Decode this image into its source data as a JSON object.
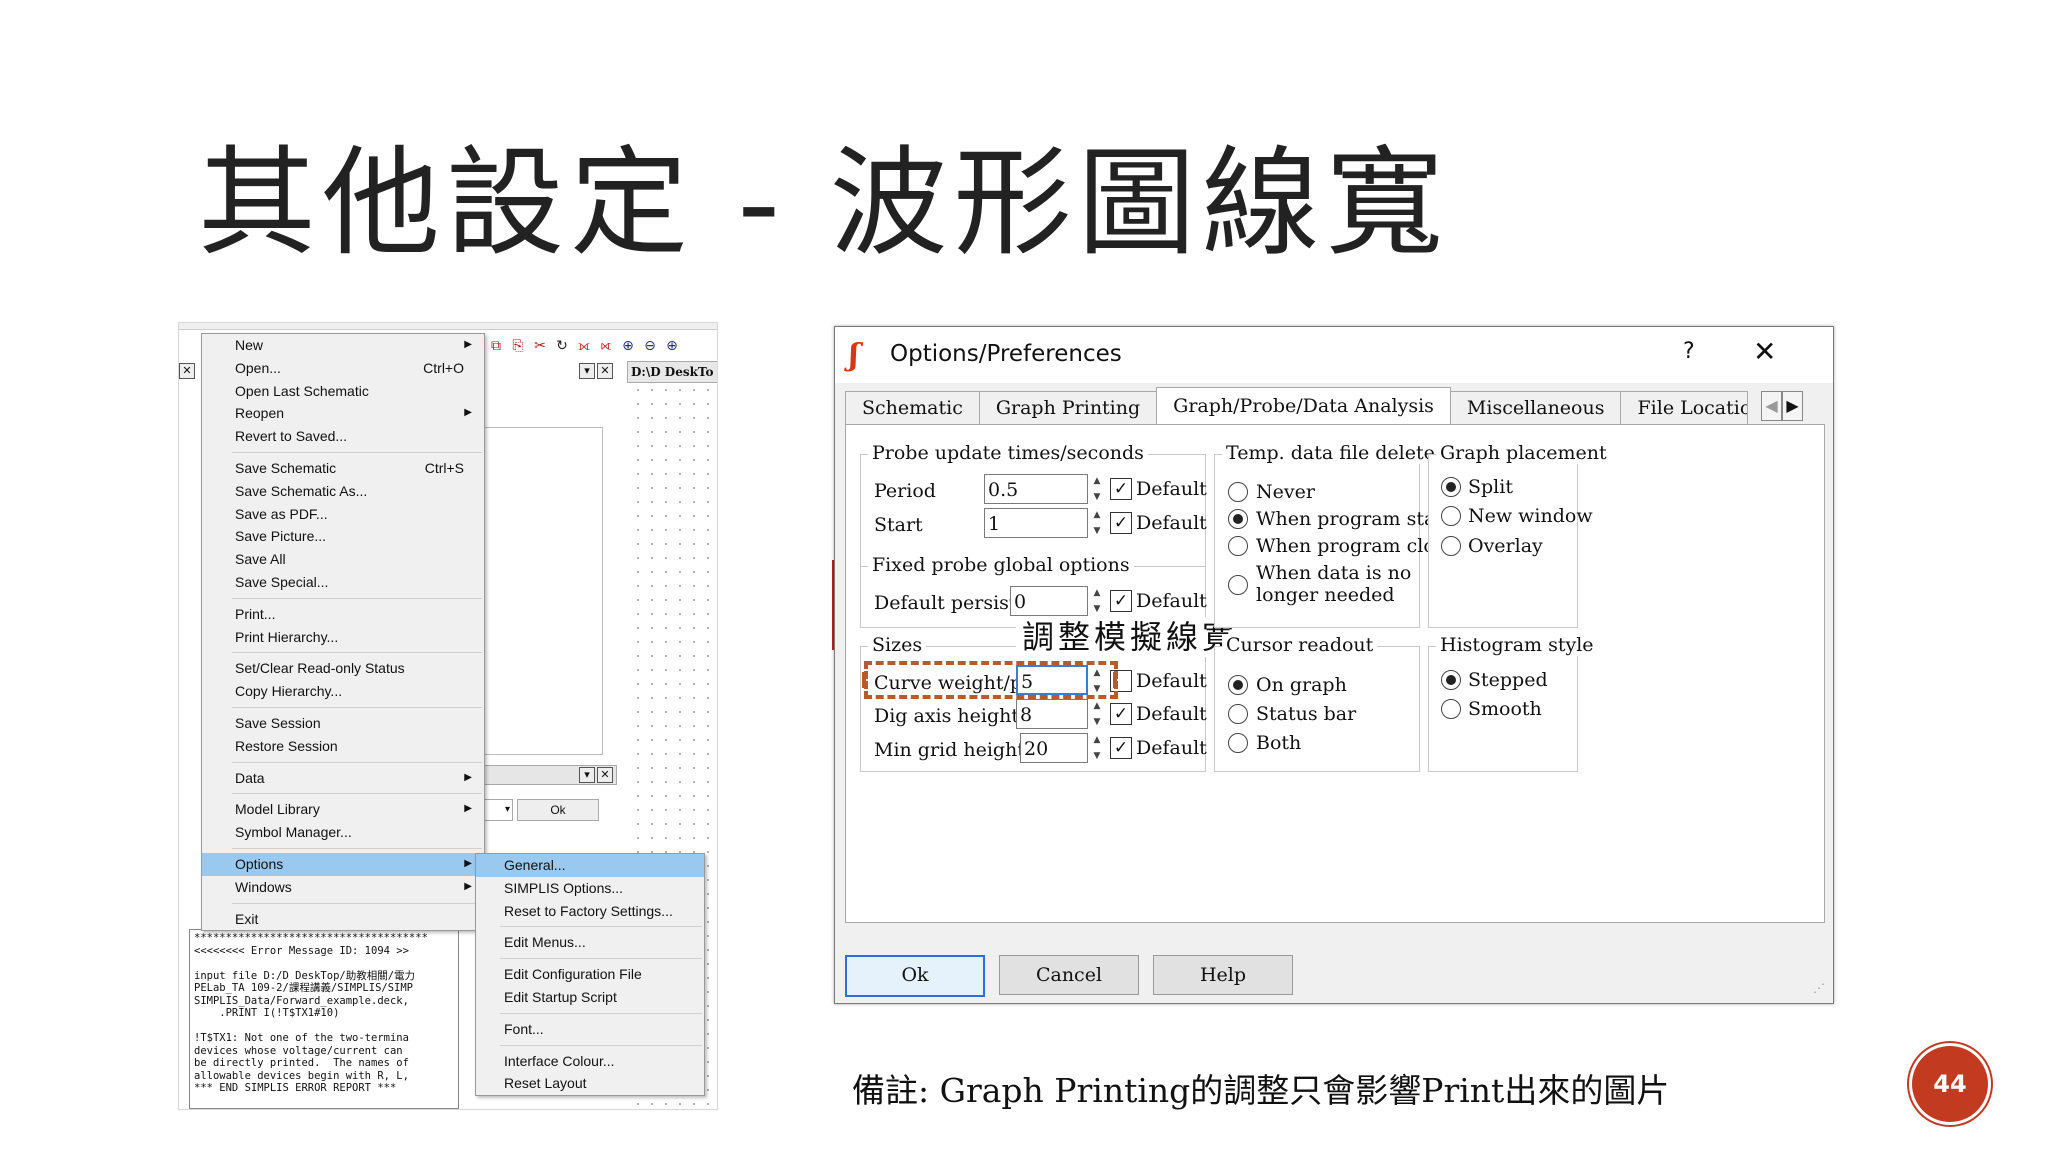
{
  "slide": {
    "title": "其他設定 - 波形圖線寬",
    "note": "備註: Graph Printing的調整只會影響Print出來的圖片",
    "page_number": "44",
    "accent_color": "#c23a1f"
  },
  "left_screenshot": {
    "file_menu": [
      {
        "label": "New",
        "shortcut": "",
        "submenu": true
      },
      {
        "label": "Open...",
        "shortcut": "Ctrl+O",
        "submenu": false
      },
      {
        "label": "Open Last Schematic",
        "shortcut": "",
        "submenu": false
      },
      {
        "label": "Reopen",
        "shortcut": "",
        "submenu": true
      },
      {
        "label": "Revert to Saved...",
        "shortcut": "",
        "submenu": false
      },
      {
        "label": "Save Schematic",
        "shortcut": "Ctrl+S",
        "submenu": false
      },
      {
        "label": "Save Schematic As...",
        "shortcut": "",
        "submenu": false
      },
      {
        "label": "Save as PDF...",
        "shortcut": "",
        "submenu": false
      },
      {
        "label": "Save Picture...",
        "shortcut": "",
        "submenu": false
      },
      {
        "label": "Save All",
        "shortcut": "",
        "submenu": false
      },
      {
        "label": "Save Special...",
        "shortcut": "",
        "submenu": false
      },
      {
        "label": "Print...",
        "shortcut": "",
        "submenu": false
      },
      {
        "label": "Print Hierarchy...",
        "shortcut": "",
        "submenu": false
      },
      {
        "label": "Set/Clear Read-only Status",
        "shortcut": "",
        "submenu": false
      },
      {
        "label": "Copy Hierarchy...",
        "shortcut": "",
        "submenu": false
      },
      {
        "label": "Save Session",
        "shortcut": "",
        "submenu": false
      },
      {
        "label": "Restore Session",
        "shortcut": "",
        "submenu": false
      },
      {
        "label": "Data",
        "shortcut": "",
        "submenu": true
      },
      {
        "label": "Model Library",
        "shortcut": "",
        "submenu": true
      },
      {
        "label": "Symbol Manager...",
        "shortcut": "",
        "submenu": false
      },
      {
        "label": "Options",
        "shortcut": "",
        "submenu": true
      },
      {
        "label": "Windows",
        "shortcut": "",
        "submenu": true
      },
      {
        "label": "Exit",
        "shortcut": "",
        "submenu": false
      }
    ],
    "options_submenu": [
      "General...",
      "SIMPLIS Options...",
      "Reset to Factory Settings...",
      "Edit Menus...",
      "Edit Configuration File",
      "Edit Startup Script",
      "Font...",
      "Interface Colour...",
      "Reset Layout"
    ],
    "path_label": "D:\\D DeskTo",
    "ok_label": "Ok",
    "error_lines": [
      "*************************************",
      "<<<<<<<< Error Message ID: 1094 >>",
      "",
      "input file D:/D DeskTop/助教相關/電力",
      "PELab_TA 109-2/課程講義/SIMPLIS/SIMP",
      "SIMPLIS_Data/Forward_example.deck,",
      "    .PRINT I(!T$TX1#10)",
      "",
      "!T$TX1: Not one of the two-termina",
      "devices whose voltage/current can",
      "be directly printed.  The names of",
      "allowable devices begin with R, L,",
      "*** END SIMPLIS ERROR REPORT ***"
    ]
  },
  "dialog": {
    "title": "Options/Preferences",
    "help": "?",
    "close": "✕",
    "tabs": [
      "Schematic",
      "Graph Printing",
      "Graph/Probe/Data Analysis",
      "Miscellaneous",
      "File Locations"
    ],
    "active_tab": "Graph/Probe/Data Analysis",
    "probe_update": {
      "title": "Probe update times/seconds",
      "period_label": "Period",
      "period_value": "0.5",
      "start_label": "Start",
      "start_value": "1",
      "default_label": "Default"
    },
    "fixed_probe": {
      "title": "Fixed probe global options",
      "persistence_label": "Default persistence",
      "persistence_value": "0",
      "default_label": "Default"
    },
    "sizes": {
      "title": "Sizes",
      "curve_label": "Curve weight/pixels",
      "curve_value": "5",
      "dig_label": "Dig axis height/mm",
      "dig_value": "8",
      "grid_label": "Min grid height/mm",
      "grid_value": "20",
      "default_label": "Default"
    },
    "temp_delete": {
      "title": "Temp. data file delete",
      "options": [
        "Never",
        "When program starts",
        "When program closes",
        "When data is no",
        "longer needed"
      ],
      "selected": "When program starts"
    },
    "graph_placement": {
      "title": "Graph placement",
      "options": [
        "Split",
        "New window",
        "Overlay"
      ],
      "selected": "Split"
    },
    "cursor_readout": {
      "title": "Cursor readout",
      "options": [
        "On graph",
        "Status bar",
        "Both"
      ],
      "selected": "On graph"
    },
    "histogram_style": {
      "title": "Histogram style",
      "options": [
        "Stepped",
        "Smooth"
      ],
      "selected": "Stepped"
    },
    "buttons": {
      "ok": "Ok",
      "cancel": "Cancel",
      "help": "Help"
    },
    "callout": "調整模擬線寬",
    "highlight_color": "#b85a2a"
  }
}
